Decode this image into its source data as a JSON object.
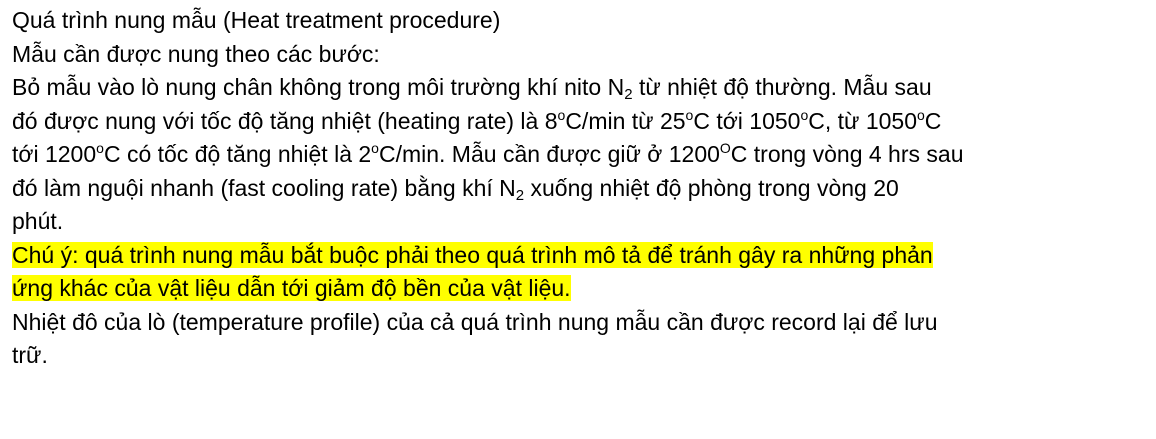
{
  "document": {
    "title": "Quá trình nung mẫu (Heat treatment procedure)",
    "intro": "Mẫu cần được nung theo các bước:",
    "procedure": {
      "l1_a": "Bỏ mẫu vào lò nung chân không trong môi trường khí nito N",
      "l1_sub": "2",
      "l1_b": " từ nhiệt độ thường. Mẫu sau",
      "l2_a": "đó được nung với tốc độ tăng nhiệt (heating rate) là 8",
      "l2_sup1": "o",
      "l2_b": "C/min từ 25",
      "l2_sup2": "o",
      "l2_c": "C tới 1050",
      "l2_sup3": "o",
      "l2_d": "C, từ 1050",
      "l2_sup4": "o",
      "l2_e": "C",
      "l3_a": "tới 1200",
      "l3_sup1": "o",
      "l3_b": "C có tốc độ tăng nhiệt là 2",
      "l3_sup2": "o",
      "l3_c": "C/min. Mẫu cần được giữ ở 1200",
      "l3_sup3": "O",
      "l3_d": "C trong vòng 4 hrs sau",
      "l4_a": "đó làm nguội nhanh (fast cooling rate) bằng khí N",
      "l4_sub": "2",
      "l4_b": " xuống nhiệt độ phòng trong vòng 20",
      "l5": "phút."
    },
    "note": {
      "line1": "Chú ý:  quá trình nung mẫu bắt buộc phải theo quá trình mô tả để tránh gây ra những phản",
      "line2": "ứng khác của vật liệu dẫn tới giảm độ bền của vật liệu."
    },
    "record": {
      "line1": "Nhiệt đô của lò (temperature profile) của cả quá trình nung mẫu cần được record lại để lưu",
      "line2": "trữ."
    },
    "highlight_color": "#ffff00"
  }
}
